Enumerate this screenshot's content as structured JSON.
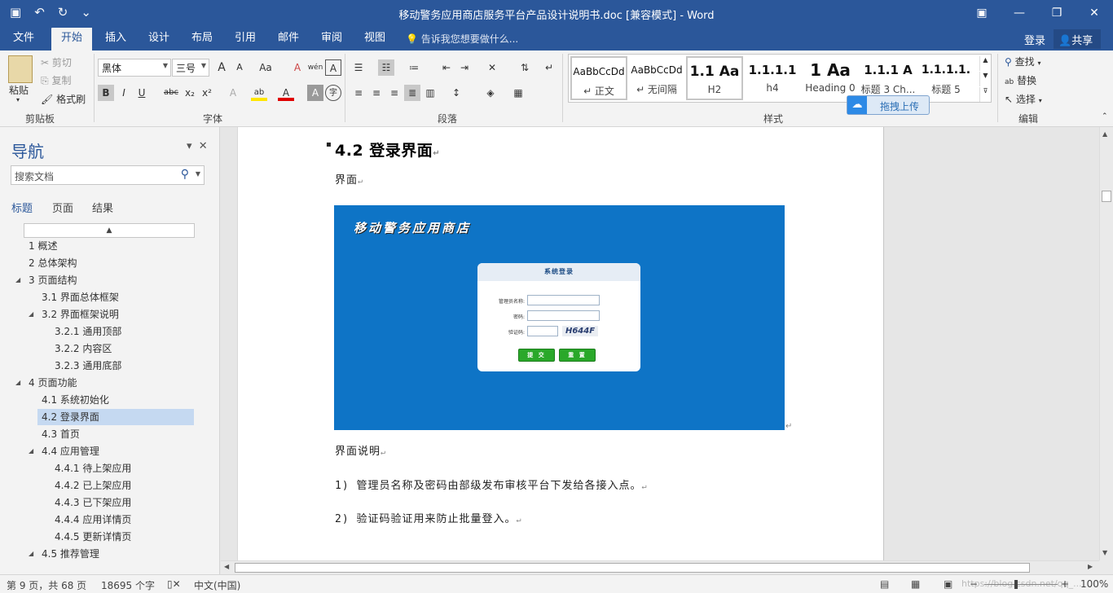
{
  "window": {
    "title": "移动警务应用商店服务平台产品设计说明书.doc [兼容模式] - Word",
    "buttons": {
      "ribbon_display": "▣",
      "minimize": "—",
      "restore": "❐",
      "close": "✕"
    }
  },
  "quick_access": {
    "save": "▣",
    "undo": "↶",
    "redo": "↻",
    "customize": "⌄"
  },
  "tabs": [
    {
      "label": "文件"
    },
    {
      "label": "开始"
    },
    {
      "label": "插入"
    },
    {
      "label": "设计"
    },
    {
      "label": "布局"
    },
    {
      "label": "引用"
    },
    {
      "label": "邮件"
    },
    {
      "label": "审阅"
    },
    {
      "label": "视图"
    }
  ],
  "tell_me": "告诉我您想要做什么...",
  "account": {
    "login": "登录",
    "share": "共享"
  },
  "ribbon": {
    "clipboard": {
      "paste": "粘贴",
      "cut": "剪切",
      "copy": "复制",
      "format_painter": "格式刷",
      "group": "剪贴板"
    },
    "font": {
      "family": "黑体",
      "size": "三号",
      "group": "字体",
      "case_btn": "Aa",
      "wen": "wén",
      "bold": "B",
      "italic": "I",
      "underline": "U",
      "strike": "abc",
      "sub": "x₂",
      "sup": "x²",
      "grow": "A",
      "shrink": "A",
      "clear_fmt": "A",
      "char_border": "A",
      "effects": "A",
      "highlight": "ab",
      "font_color": "A",
      "char_shade": "A",
      "enclose": "字"
    },
    "paragraph": {
      "group": "段落"
    },
    "styles": {
      "group": "样式",
      "items": [
        {
          "sample": "AaBbCcDd",
          "name": "↵ 正文"
        },
        {
          "sample": "AaBbCcDd",
          "name": "↵ 无间隔"
        },
        {
          "sample": "1.1  Aa",
          "name": "H2"
        },
        {
          "sample": "1.1.1.1",
          "name": "h4"
        },
        {
          "sample": "1  Aa",
          "name": "Heading 0"
        },
        {
          "sample": "1.1.1  A",
          "name": "标题 3 Ch..."
        },
        {
          "sample": "1.1.1.1.",
          "name": "标题 5"
        }
      ]
    },
    "editing": {
      "find": "查找",
      "replace": "替换",
      "select": "选择",
      "group": "编辑"
    },
    "upload": "拖拽上传"
  },
  "nav": {
    "title": "导航",
    "search_placeholder": "搜索文档",
    "tabs": [
      {
        "label": "标题"
      },
      {
        "label": "页面"
      },
      {
        "label": "结果"
      }
    ],
    "items": [
      {
        "label": "1 概述",
        "level": 1,
        "expand": ""
      },
      {
        "label": "2 总体架构",
        "level": 1,
        "expand": ""
      },
      {
        "label": "3 页面结构",
        "level": 1,
        "expand": "◢"
      },
      {
        "label": "3.1 界面总体框架",
        "level": 2,
        "expand": ""
      },
      {
        "label": "3.2 界面框架说明",
        "level": 2,
        "expand": "◢"
      },
      {
        "label": "3.2.1 通用顶部",
        "level": 3,
        "expand": ""
      },
      {
        "label": "3.2.2 内容区",
        "level": 3,
        "expand": ""
      },
      {
        "label": "3.2.3 通用底部",
        "level": 3,
        "expand": ""
      },
      {
        "label": "4 页面功能",
        "level": 1,
        "expand": "◢"
      },
      {
        "label": "4.1 系统初始化",
        "level": 2,
        "expand": ""
      },
      {
        "label": "4.2 登录界面",
        "level": 2,
        "expand": "",
        "selected": true
      },
      {
        "label": "4.3 首页",
        "level": 2,
        "expand": ""
      },
      {
        "label": "4.4 应用管理",
        "level": 2,
        "expand": "◢"
      },
      {
        "label": "4.4.1 待上架应用",
        "level": 3,
        "expand": ""
      },
      {
        "label": "4.4.2 已上架应用",
        "level": 3,
        "expand": ""
      },
      {
        "label": "4.4.3 已下架应用",
        "level": 3,
        "expand": ""
      },
      {
        "label": "4.4.4 应用详情页",
        "level": 3,
        "expand": ""
      },
      {
        "label": "4.4.5 更新详情页",
        "level": 3,
        "expand": ""
      },
      {
        "label": "4.5 推荐管理",
        "level": 2,
        "expand": "◢"
      }
    ]
  },
  "doc": {
    "heading": "4.2 登录界面",
    "p_jiemian": "界面",
    "p_shuoming": "界面说明",
    "item1": "1)  管理员名称及密码由部级发布审核平台下发给各接入点。",
    "item2": "2)  验证码验证用来防止批量登入。",
    "mark": "↵"
  },
  "screenshot": {
    "brand": "移动警务应用商店",
    "login_title": "系统登录",
    "label_user": "管理员名称:",
    "label_pwd": "密码:",
    "label_code": "验证码:",
    "captcha": "H644F",
    "submit": "提 交",
    "reset": "重 置"
  },
  "status": {
    "page": "第 9 页，共 68 页",
    "words": "18695 个字",
    "lang": "中文(中国)",
    "zoom": "100%",
    "watermark": "https://blog.csdn.net/qq_..."
  }
}
